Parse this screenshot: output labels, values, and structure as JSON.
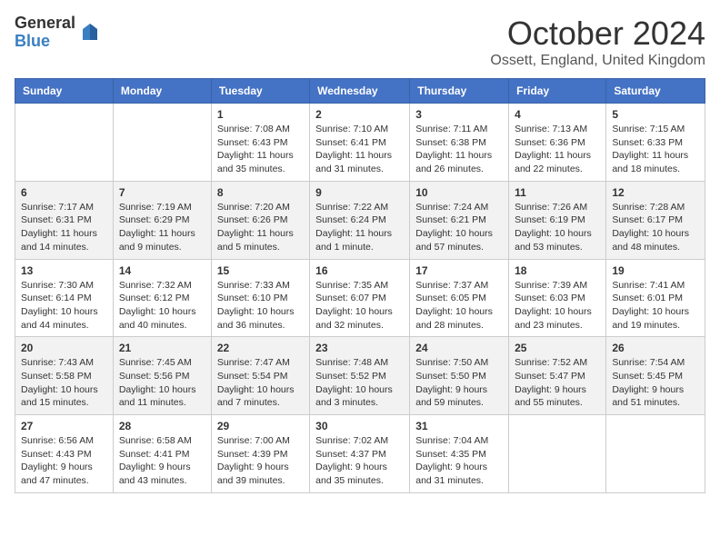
{
  "logo": {
    "general": "General",
    "blue": "Blue"
  },
  "title": {
    "month": "October 2024",
    "location": "Ossett, England, United Kingdom"
  },
  "weekdays": [
    "Sunday",
    "Monday",
    "Tuesday",
    "Wednesday",
    "Thursday",
    "Friday",
    "Saturday"
  ],
  "weeks": [
    [
      null,
      null,
      {
        "day": 1,
        "sunrise": "7:08 AM",
        "sunset": "6:43 PM",
        "daylight": "11 hours and 35 minutes."
      },
      {
        "day": 2,
        "sunrise": "7:10 AM",
        "sunset": "6:41 PM",
        "daylight": "11 hours and 31 minutes."
      },
      {
        "day": 3,
        "sunrise": "7:11 AM",
        "sunset": "6:38 PM",
        "daylight": "11 hours and 26 minutes."
      },
      {
        "day": 4,
        "sunrise": "7:13 AM",
        "sunset": "6:36 PM",
        "daylight": "11 hours and 22 minutes."
      },
      {
        "day": 5,
        "sunrise": "7:15 AM",
        "sunset": "6:33 PM",
        "daylight": "11 hours and 18 minutes."
      }
    ],
    [
      {
        "day": 6,
        "sunrise": "7:17 AM",
        "sunset": "6:31 PM",
        "daylight": "11 hours and 14 minutes."
      },
      {
        "day": 7,
        "sunrise": "7:19 AM",
        "sunset": "6:29 PM",
        "daylight": "11 hours and 9 minutes."
      },
      {
        "day": 8,
        "sunrise": "7:20 AM",
        "sunset": "6:26 PM",
        "daylight": "11 hours and 5 minutes."
      },
      {
        "day": 9,
        "sunrise": "7:22 AM",
        "sunset": "6:24 PM",
        "daylight": "11 hours and 1 minute."
      },
      {
        "day": 10,
        "sunrise": "7:24 AM",
        "sunset": "6:21 PM",
        "daylight": "10 hours and 57 minutes."
      },
      {
        "day": 11,
        "sunrise": "7:26 AM",
        "sunset": "6:19 PM",
        "daylight": "10 hours and 53 minutes."
      },
      {
        "day": 12,
        "sunrise": "7:28 AM",
        "sunset": "6:17 PM",
        "daylight": "10 hours and 48 minutes."
      }
    ],
    [
      {
        "day": 13,
        "sunrise": "7:30 AM",
        "sunset": "6:14 PM",
        "daylight": "10 hours and 44 minutes."
      },
      {
        "day": 14,
        "sunrise": "7:32 AM",
        "sunset": "6:12 PM",
        "daylight": "10 hours and 40 minutes."
      },
      {
        "day": 15,
        "sunrise": "7:33 AM",
        "sunset": "6:10 PM",
        "daylight": "10 hours and 36 minutes."
      },
      {
        "day": 16,
        "sunrise": "7:35 AM",
        "sunset": "6:07 PM",
        "daylight": "10 hours and 32 minutes."
      },
      {
        "day": 17,
        "sunrise": "7:37 AM",
        "sunset": "6:05 PM",
        "daylight": "10 hours and 28 minutes."
      },
      {
        "day": 18,
        "sunrise": "7:39 AM",
        "sunset": "6:03 PM",
        "daylight": "10 hours and 23 minutes."
      },
      {
        "day": 19,
        "sunrise": "7:41 AM",
        "sunset": "6:01 PM",
        "daylight": "10 hours and 19 minutes."
      }
    ],
    [
      {
        "day": 20,
        "sunrise": "7:43 AM",
        "sunset": "5:58 PM",
        "daylight": "10 hours and 15 minutes."
      },
      {
        "day": 21,
        "sunrise": "7:45 AM",
        "sunset": "5:56 PM",
        "daylight": "10 hours and 11 minutes."
      },
      {
        "day": 22,
        "sunrise": "7:47 AM",
        "sunset": "5:54 PM",
        "daylight": "10 hours and 7 minutes."
      },
      {
        "day": 23,
        "sunrise": "7:48 AM",
        "sunset": "5:52 PM",
        "daylight": "10 hours and 3 minutes."
      },
      {
        "day": 24,
        "sunrise": "7:50 AM",
        "sunset": "5:50 PM",
        "daylight": "9 hours and 59 minutes."
      },
      {
        "day": 25,
        "sunrise": "7:52 AM",
        "sunset": "5:47 PM",
        "daylight": "9 hours and 55 minutes."
      },
      {
        "day": 26,
        "sunrise": "7:54 AM",
        "sunset": "5:45 PM",
        "daylight": "9 hours and 51 minutes."
      }
    ],
    [
      {
        "day": 27,
        "sunrise": "6:56 AM",
        "sunset": "4:43 PM",
        "daylight": "9 hours and 47 minutes."
      },
      {
        "day": 28,
        "sunrise": "6:58 AM",
        "sunset": "4:41 PM",
        "daylight": "9 hours and 43 minutes."
      },
      {
        "day": 29,
        "sunrise": "7:00 AM",
        "sunset": "4:39 PM",
        "daylight": "9 hours and 39 minutes."
      },
      {
        "day": 30,
        "sunrise": "7:02 AM",
        "sunset": "4:37 PM",
        "daylight": "9 hours and 35 minutes."
      },
      {
        "day": 31,
        "sunrise": "7:04 AM",
        "sunset": "4:35 PM",
        "daylight": "9 hours and 31 minutes."
      },
      null,
      null
    ]
  ]
}
